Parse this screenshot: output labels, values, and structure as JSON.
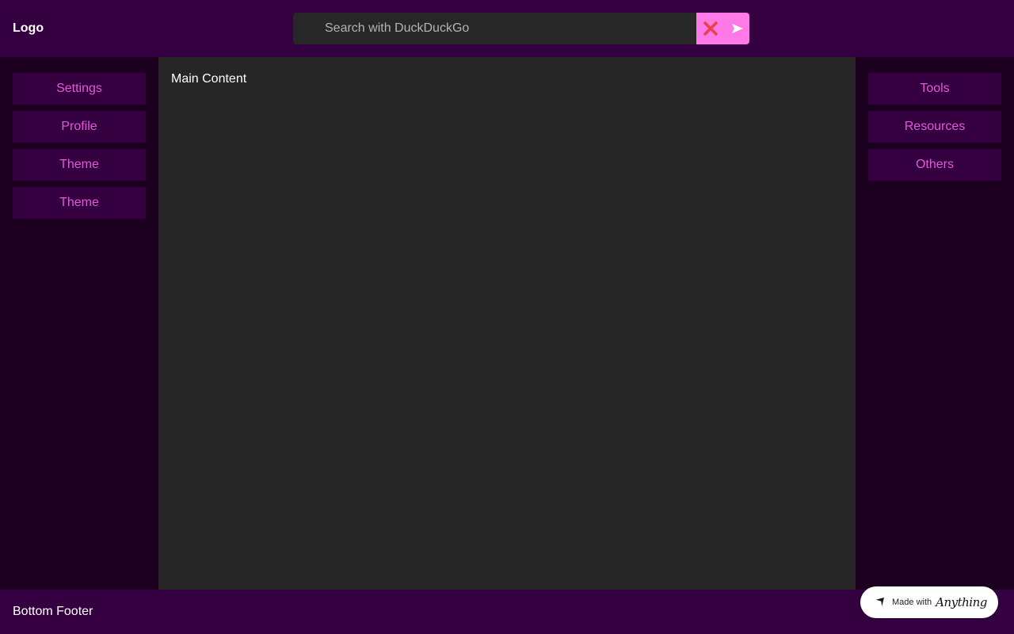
{
  "header": {
    "logo": "Logo",
    "search": {
      "placeholder": "Search with DuckDuckGo",
      "value": ""
    },
    "clear_icon": "close-icon",
    "submit_icon": "send-icon"
  },
  "sidebar_left": {
    "items": [
      {
        "label": "Settings"
      },
      {
        "label": "Profile"
      },
      {
        "label": "Theme"
      },
      {
        "label": "Theme"
      }
    ]
  },
  "sidebar_right": {
    "items": [
      {
        "label": "Tools"
      },
      {
        "label": "Resources"
      },
      {
        "label": "Others"
      }
    ]
  },
  "main": {
    "title": "Main Content"
  },
  "footer": {
    "text": "Bottom Footer"
  },
  "badge": {
    "prefix": "Made with",
    "brand": "Anything"
  },
  "colors": {
    "header_bg": "#340040",
    "sidebar_bg": "#1c0020",
    "main_bg": "#262626",
    "accent": "#ff7ae8",
    "nav_text": "#e05ad8",
    "clear_icon": "#e8414b"
  }
}
